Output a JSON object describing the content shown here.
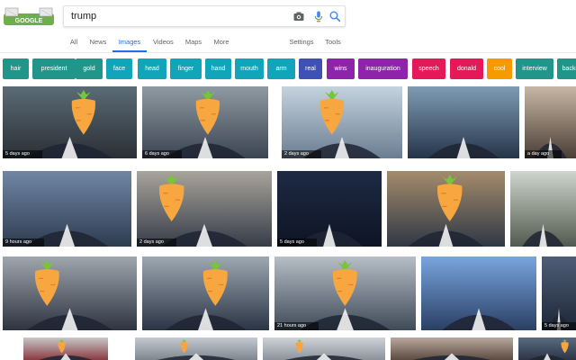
{
  "search": {
    "query": "trump",
    "camera_icon": "camera-icon",
    "mic_icon": "mic-icon",
    "search_icon": "search-icon"
  },
  "logo": {
    "text": "GOOGLE"
  },
  "tabs": {
    "all": "All",
    "news": "News",
    "images": "Images",
    "videos": "Videos",
    "maps": "Maps",
    "more": "More",
    "settings": "Settings",
    "tools": "Tools",
    "active": "Images"
  },
  "chips": [
    {
      "label": "hair",
      "color": "#21958a"
    },
    {
      "label": "president",
      "color": "#21958a"
    },
    {
      "label": "gold",
      "color": "#21958a"
    },
    {
      "label": "face",
      "color": "#12a4b8"
    },
    {
      "label": "head",
      "color": "#12a4b8"
    },
    {
      "label": "finger",
      "color": "#12a4b8"
    },
    {
      "label": "hand",
      "color": "#12a4b8"
    },
    {
      "label": "mouth",
      "color": "#12a4b8"
    },
    {
      "label": "arm",
      "color": "#12a4b8"
    },
    {
      "label": "real",
      "color": "#3f51b5"
    },
    {
      "label": "wins",
      "color": "#8e24aa"
    },
    {
      "label": "inauguration",
      "color": "#8e24aa"
    },
    {
      "label": "speech",
      "color": "#e5195a"
    },
    {
      "label": "donald",
      "color": "#e5195a"
    },
    {
      "label": "cool",
      "color": "#f59b00"
    },
    {
      "label": "interview",
      "color": "#21958a"
    },
    {
      "label": "backg",
      "color": "#21958a"
    }
  ],
  "results": [
    {
      "badge": "5 days ago"
    },
    {
      "badge": "6 days ago"
    },
    {
      "badge": "2 days ago"
    },
    {
      "badge": ""
    },
    {
      "badge": "a day ago"
    },
    {
      "badge": "9 hours ago"
    },
    {
      "badge": "2 days ago"
    },
    {
      "badge": "5 days ago"
    },
    {
      "badge": ""
    },
    {
      "badge": ""
    },
    {
      "badge": ""
    },
    {
      "badge": ""
    },
    {
      "badge": "21 hours ago"
    },
    {
      "badge": ""
    },
    {
      "badge": "5 days ago"
    },
    {
      "badge": ""
    },
    {
      "badge": ""
    },
    {
      "badge": ""
    },
    {
      "badge": ""
    },
    {
      "badge": ""
    }
  ],
  "colors": {
    "accent": "#1a73e8",
    "carrot_body": "#f7a640",
    "carrot_leaves": "#78c43a"
  }
}
